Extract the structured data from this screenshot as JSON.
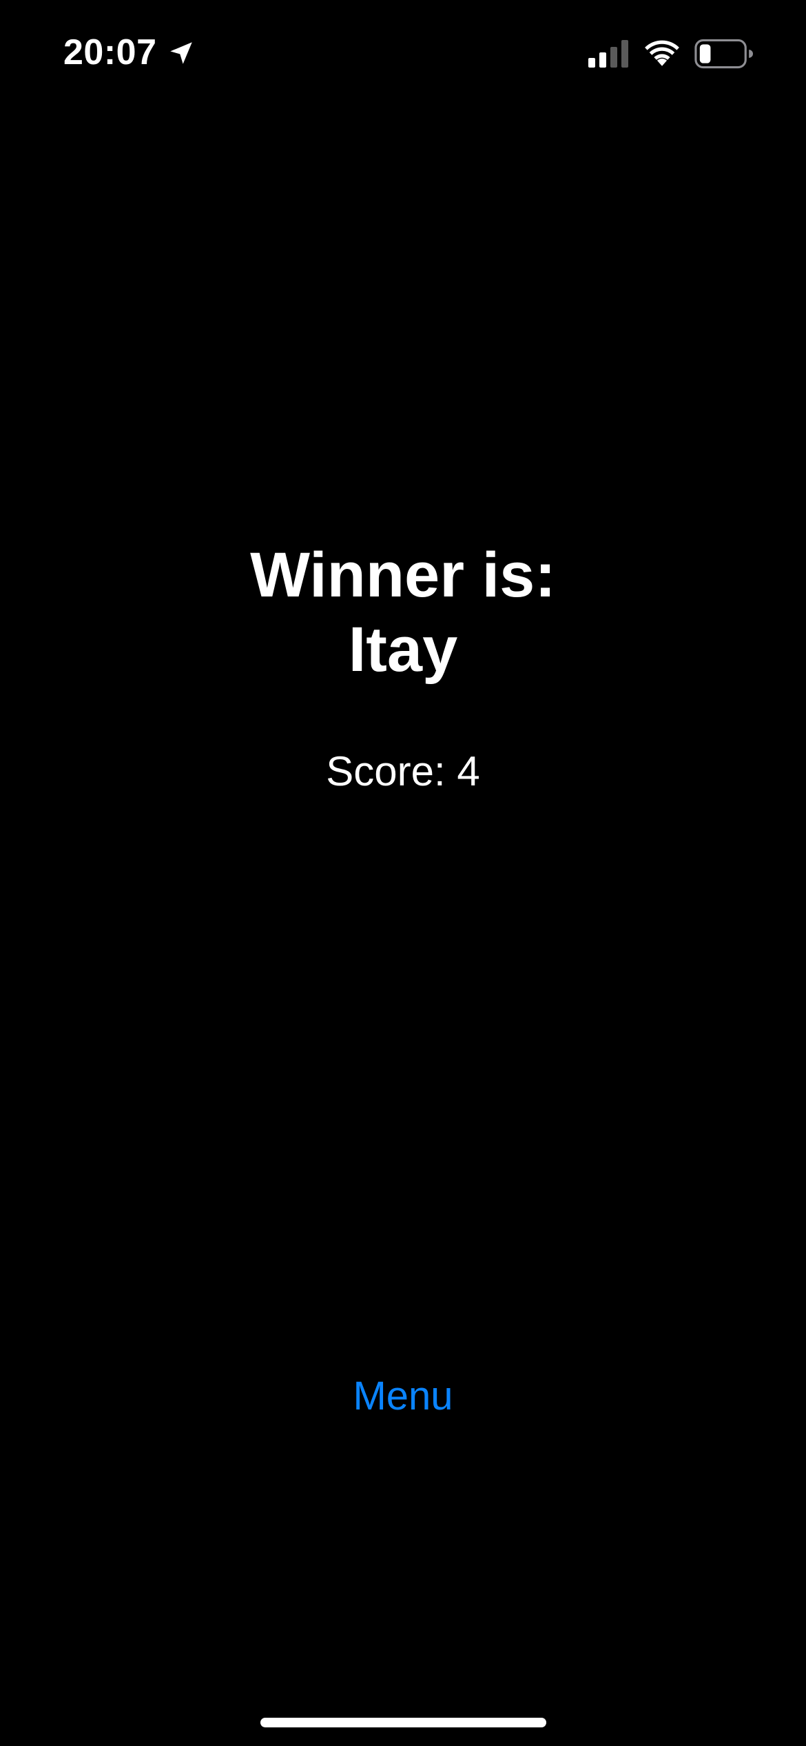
{
  "status_bar": {
    "time": "20:07",
    "icons": {
      "location": "location-arrow-icon",
      "signal": "cellular-signal-icon",
      "wifi": "wifi-icon",
      "battery": "battery-icon"
    },
    "signal_bars_active": 2,
    "signal_bars_total": 4,
    "battery_level": 0.25
  },
  "result": {
    "title": "Winner is:",
    "winner_name": "Itay",
    "score_text": "Score: 4"
  },
  "actions": {
    "menu_label": "Menu"
  },
  "colors": {
    "background": "#000000",
    "text": "#ffffff",
    "accent": "#0a84ff"
  }
}
